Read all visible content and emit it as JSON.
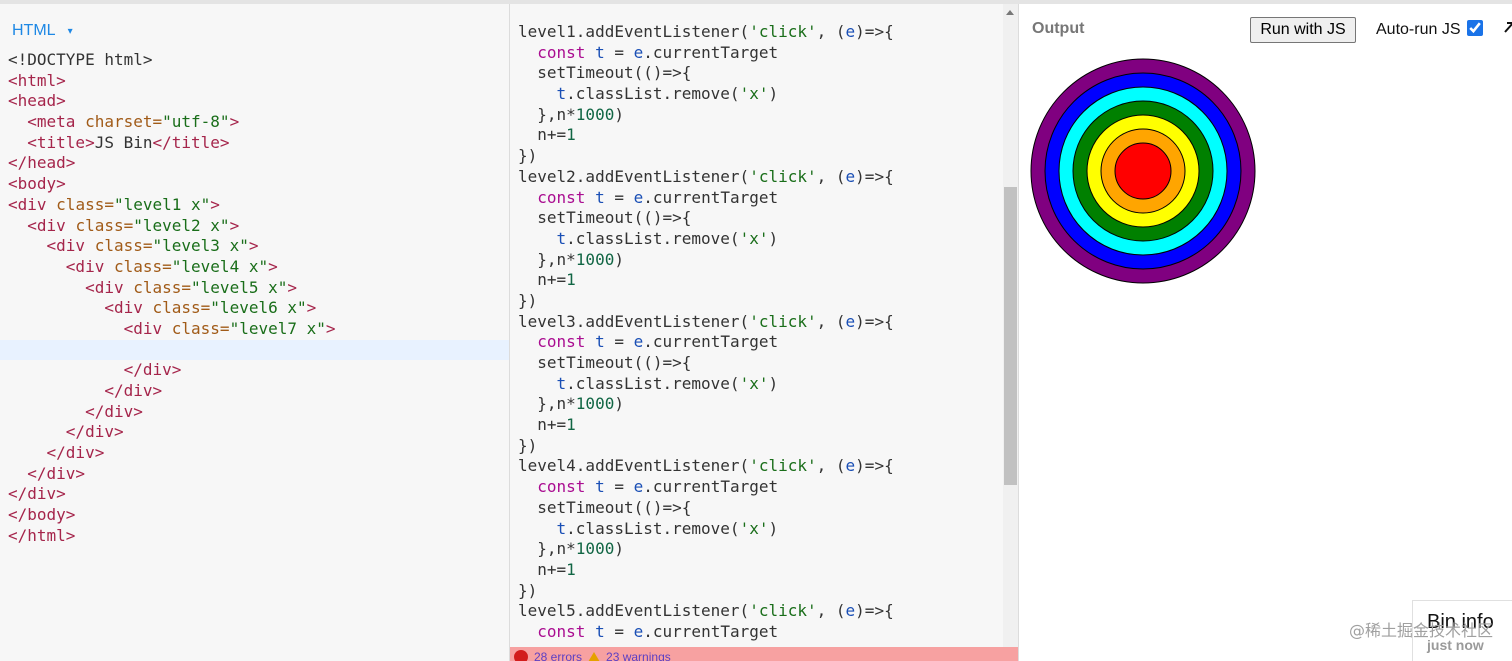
{
  "html_panel": {
    "label": "HTML",
    "caret": "▾",
    "lines": [
      [
        [
          "t-txt",
          "<!DOCTYPE html>"
        ]
      ],
      [
        [
          "t-tag",
          "<html>"
        ]
      ],
      [
        [
          "t-tag",
          "<head>"
        ]
      ],
      [
        [
          "t-txt",
          "  "
        ],
        [
          "t-tag",
          "<meta "
        ],
        [
          "t-attr",
          "charset="
        ],
        [
          "t-str",
          "\"utf-8\""
        ],
        [
          "t-tag",
          ">"
        ]
      ],
      [
        [
          "t-txt",
          "  "
        ],
        [
          "t-tag",
          "<title>"
        ],
        [
          "t-txt",
          "JS Bin"
        ],
        [
          "t-tag",
          "</title>"
        ]
      ],
      [
        [
          "t-tag",
          "</head>"
        ]
      ],
      [
        [
          "t-tag",
          "<body>"
        ]
      ],
      [
        [
          "t-tag",
          "<div "
        ],
        [
          "t-attr",
          "class="
        ],
        [
          "t-str",
          "\"level1 x\""
        ],
        [
          "t-tag",
          ">"
        ]
      ],
      [
        [
          "t-txt",
          "  "
        ],
        [
          "t-tag",
          "<div "
        ],
        [
          "t-attr",
          "class="
        ],
        [
          "t-str",
          "\"level2 x\""
        ],
        [
          "t-tag",
          ">"
        ]
      ],
      [
        [
          "t-txt",
          "    "
        ],
        [
          "t-tag",
          "<div "
        ],
        [
          "t-attr",
          "class="
        ],
        [
          "t-str",
          "\"level3 x\""
        ],
        [
          "t-tag",
          ">"
        ]
      ],
      [
        [
          "t-txt",
          "      "
        ],
        [
          "t-tag",
          "<div "
        ],
        [
          "t-attr",
          "class="
        ],
        [
          "t-str",
          "\"level4 x\""
        ],
        [
          "t-tag",
          ">"
        ]
      ],
      [
        [
          "t-txt",
          "        "
        ],
        [
          "t-tag",
          "<div "
        ],
        [
          "t-attr",
          "class="
        ],
        [
          "t-str",
          "\"level5 x\""
        ],
        [
          "t-tag",
          ">"
        ]
      ],
      [
        [
          "t-txt",
          "          "
        ],
        [
          "t-tag",
          "<div "
        ],
        [
          "t-attr",
          "class="
        ],
        [
          "t-str",
          "\"level6 x\""
        ],
        [
          "t-tag",
          ">"
        ]
      ],
      [
        [
          "t-txt",
          "            "
        ],
        [
          "t-tag",
          "<div "
        ],
        [
          "t-attr",
          "class="
        ],
        [
          "t-str",
          "\"level7 x\""
        ],
        [
          "t-tag",
          ">"
        ]
      ],
      [],
      [
        [
          "t-txt",
          "            "
        ],
        [
          "t-tag",
          "</div>"
        ]
      ],
      [
        [
          "t-txt",
          "          "
        ],
        [
          "t-tag",
          "</div>"
        ]
      ],
      [
        [
          "t-txt",
          "        "
        ],
        [
          "t-tag",
          "</div>"
        ]
      ],
      [
        [
          "t-txt",
          "      "
        ],
        [
          "t-tag",
          "</div>"
        ]
      ],
      [
        [
          "t-txt",
          "    "
        ],
        [
          "t-tag",
          "</div>"
        ]
      ],
      [
        [
          "t-txt",
          "  "
        ],
        [
          "t-tag",
          "</div>"
        ]
      ],
      [
        [
          "t-tag",
          "</div>"
        ]
      ],
      [
        [
          "t-tag",
          "</body>"
        ]
      ],
      [
        [
          "t-tag",
          "</html>"
        ]
      ]
    ],
    "active_line": 14
  },
  "js_panel": {
    "lines": [
      [
        [
          "t-txt",
          "level1.addEventListener("
        ],
        [
          "t-str",
          "'click'"
        ],
        [
          "t-txt",
          ", ("
        ],
        [
          "t-var",
          "e"
        ],
        [
          "t-txt",
          ")=>{"
        ]
      ],
      [
        [
          "t-txt",
          "  "
        ],
        [
          "t-kw",
          "const"
        ],
        [
          "t-txt",
          " "
        ],
        [
          "t-var",
          "t"
        ],
        [
          "t-txt",
          " = "
        ],
        [
          "t-var",
          "e"
        ],
        [
          "t-txt",
          ".currentTarget"
        ]
      ],
      [
        [
          "t-txt",
          "  setTimeout(()=>{"
        ]
      ],
      [
        [
          "t-txt",
          "    "
        ],
        [
          "t-var",
          "t"
        ],
        [
          "t-txt",
          ".classList.remove("
        ],
        [
          "t-str",
          "'x'"
        ],
        [
          "t-txt",
          ")"
        ]
      ],
      [
        [
          "t-txt",
          "  },n*"
        ],
        [
          "t-num",
          "1000"
        ],
        [
          "t-txt",
          ")"
        ]
      ],
      [
        [
          "t-txt",
          "  n+="
        ],
        [
          "t-num",
          "1"
        ]
      ],
      [
        [
          "t-txt",
          "})"
        ]
      ],
      [
        [
          "t-txt",
          "level2.addEventListener("
        ],
        [
          "t-str",
          "'click'"
        ],
        [
          "t-txt",
          ", ("
        ],
        [
          "t-var",
          "e"
        ],
        [
          "t-txt",
          ")=>{"
        ]
      ],
      [
        [
          "t-txt",
          "  "
        ],
        [
          "t-kw",
          "const"
        ],
        [
          "t-txt",
          " "
        ],
        [
          "t-var",
          "t"
        ],
        [
          "t-txt",
          " = "
        ],
        [
          "t-var",
          "e"
        ],
        [
          "t-txt",
          ".currentTarget"
        ]
      ],
      [
        [
          "t-txt",
          "  setTimeout(()=>{"
        ]
      ],
      [
        [
          "t-txt",
          "    "
        ],
        [
          "t-var",
          "t"
        ],
        [
          "t-txt",
          ".classList.remove("
        ],
        [
          "t-str",
          "'x'"
        ],
        [
          "t-txt",
          ")"
        ]
      ],
      [
        [
          "t-txt",
          "  },n*"
        ],
        [
          "t-num",
          "1000"
        ],
        [
          "t-txt",
          ")"
        ]
      ],
      [
        [
          "t-txt",
          "  n+="
        ],
        [
          "t-num",
          "1"
        ]
      ],
      [
        [
          "t-txt",
          "})"
        ]
      ],
      [
        [
          "t-txt",
          "level3.addEventListener("
        ],
        [
          "t-str",
          "'click'"
        ],
        [
          "t-txt",
          ", ("
        ],
        [
          "t-var",
          "e"
        ],
        [
          "t-txt",
          ")=>{"
        ]
      ],
      [
        [
          "t-txt",
          "  "
        ],
        [
          "t-kw",
          "const"
        ],
        [
          "t-txt",
          " "
        ],
        [
          "t-var",
          "t"
        ],
        [
          "t-txt",
          " = "
        ],
        [
          "t-var",
          "e"
        ],
        [
          "t-txt",
          ".currentTarget"
        ]
      ],
      [
        [
          "t-txt",
          "  setTimeout(()=>{"
        ]
      ],
      [
        [
          "t-txt",
          "    "
        ],
        [
          "t-var",
          "t"
        ],
        [
          "t-txt",
          ".classList.remove("
        ],
        [
          "t-str",
          "'x'"
        ],
        [
          "t-txt",
          ")"
        ]
      ],
      [
        [
          "t-txt",
          "  },n*"
        ],
        [
          "t-num",
          "1000"
        ],
        [
          "t-txt",
          ")"
        ]
      ],
      [
        [
          "t-txt",
          "  n+="
        ],
        [
          "t-num",
          "1"
        ]
      ],
      [
        [
          "t-txt",
          "})"
        ]
      ],
      [
        [
          "t-txt",
          "level4.addEventListener("
        ],
        [
          "t-str",
          "'click'"
        ],
        [
          "t-txt",
          ", ("
        ],
        [
          "t-var",
          "e"
        ],
        [
          "t-txt",
          ")=>{"
        ]
      ],
      [
        [
          "t-txt",
          "  "
        ],
        [
          "t-kw",
          "const"
        ],
        [
          "t-txt",
          " "
        ],
        [
          "t-var",
          "t"
        ],
        [
          "t-txt",
          " = "
        ],
        [
          "t-var",
          "e"
        ],
        [
          "t-txt",
          ".currentTarget"
        ]
      ],
      [
        [
          "t-txt",
          "  setTimeout(()=>{"
        ]
      ],
      [
        [
          "t-txt",
          "    "
        ],
        [
          "t-var",
          "t"
        ],
        [
          "t-txt",
          ".classList.remove("
        ],
        [
          "t-str",
          "'x'"
        ],
        [
          "t-txt",
          ")"
        ]
      ],
      [
        [
          "t-txt",
          "  },n*"
        ],
        [
          "t-num",
          "1000"
        ],
        [
          "t-txt",
          ")"
        ]
      ],
      [
        [
          "t-txt",
          "  n+="
        ],
        [
          "t-num",
          "1"
        ]
      ],
      [
        [
          "t-txt",
          "})"
        ]
      ],
      [
        [
          "t-txt",
          "level5.addEventListener("
        ],
        [
          "t-str",
          "'click'"
        ],
        [
          "t-txt",
          ", ("
        ],
        [
          "t-var",
          "e"
        ],
        [
          "t-txt",
          ")=>{"
        ]
      ],
      [
        [
          "t-txt",
          "  "
        ],
        [
          "t-kw",
          "const"
        ],
        [
          "t-txt",
          " "
        ],
        [
          "t-var",
          "t"
        ],
        [
          "t-txt",
          " = "
        ],
        [
          "t-var",
          "e"
        ],
        [
          "t-txt",
          ".currentTarget"
        ]
      ]
    ],
    "errors_label": "28 errors",
    "warnings_label": "23 warnings"
  },
  "output_panel": {
    "label": "Output",
    "run_button": "Run with JS",
    "autorun_label": "Auto-run JS",
    "autorun_checked": true,
    "expand_icon": "expand-arrow-icon",
    "ring_colors": [
      "#800080",
      "#0000ff",
      "#00ffff",
      "#008000",
      "#ffff00",
      "#ffa500",
      "#ff0000"
    ]
  },
  "bin_info": {
    "title": "Bin info",
    "time": "just now"
  },
  "watermark": "@稀土掘金技术社区"
}
